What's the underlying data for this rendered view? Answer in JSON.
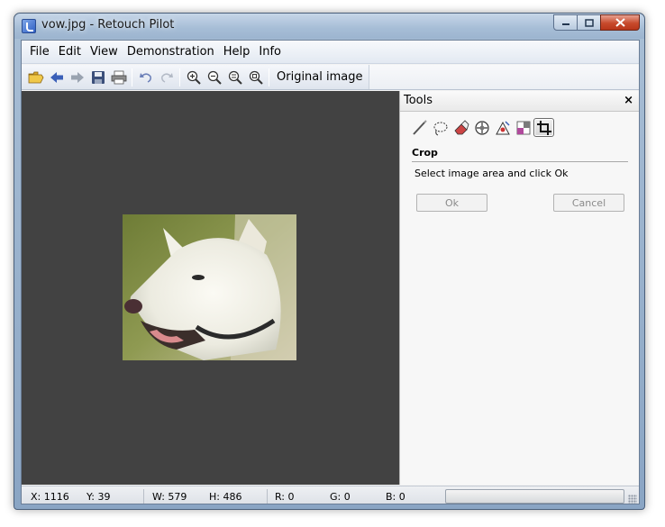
{
  "window": {
    "title": "vow.jpg - Retouch Pilot",
    "minimize": "–",
    "maximize": "□",
    "close": "✕"
  },
  "menu": {
    "items": [
      "File",
      "Edit",
      "View",
      "Demonstration",
      "Help",
      "Info"
    ]
  },
  "toolbar": {
    "icons": [
      "open-folder-icon",
      "back-arrow-icon",
      "forward-arrow-icon",
      "save-icon",
      "print-icon",
      "undo-icon",
      "redo-icon",
      "zoom-in-icon",
      "zoom-out-icon",
      "zoom-fit-icon",
      "zoom-actual-icon"
    ],
    "original_image_label": "Original image"
  },
  "canvas": {
    "background": "#424242"
  },
  "tools_panel": {
    "title": "Tools",
    "close": "×",
    "tool_icons": [
      "brush-icon",
      "lasso-select-icon",
      "eraser-icon",
      "healing-icon",
      "red-eye-icon",
      "color-icon",
      "crop-icon"
    ],
    "active_tool": "crop-icon",
    "section_title": "Crop",
    "hint": "Select image area and click Ok",
    "ok_label": "Ok",
    "cancel_label": "Cancel"
  },
  "status": {
    "x": "X: 1116",
    "y": "Y: 39",
    "w": "W: 579",
    "h": "H: 486",
    "r": "R: 0",
    "g": "G: 0",
    "b": "B: 0"
  }
}
